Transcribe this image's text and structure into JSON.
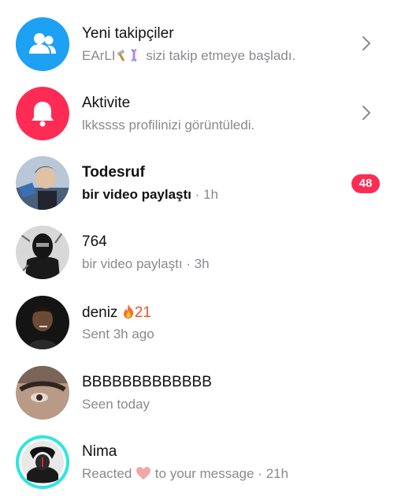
{
  "items": [
    {
      "title": "Yeni takipçiler",
      "subtitle_user": "EArLI",
      "subtitle_text": "sizi takip etmeye başladı.",
      "avatar_icon": "followers-icon",
      "avatar_color": "#1da1f2"
    },
    {
      "title": "Aktivite",
      "subtitle": "lkkssss profilinizi görüntüledi.",
      "avatar_icon": "bell-icon",
      "avatar_color": "#fe2c55"
    },
    {
      "title": "Todesruf",
      "subtitle": "bir video paylaştı",
      "time": "1h",
      "badge": "48"
    },
    {
      "title": "764",
      "subtitle": "bir video paylaştı · 3h"
    },
    {
      "title": "deniz",
      "streak": "21",
      "subtitle": "Sent 3h ago"
    },
    {
      "title": "BBBBBBBBBBBBB",
      "subtitle": "Seen today"
    },
    {
      "title": "Nima",
      "subtitle_pre": "Reacted",
      "subtitle_post": "to your message · 21h"
    }
  ],
  "colors": {
    "accent_red": "#fe2c55",
    "accent_blue": "#1da1f2",
    "muted_text": "#8a8a8e"
  }
}
